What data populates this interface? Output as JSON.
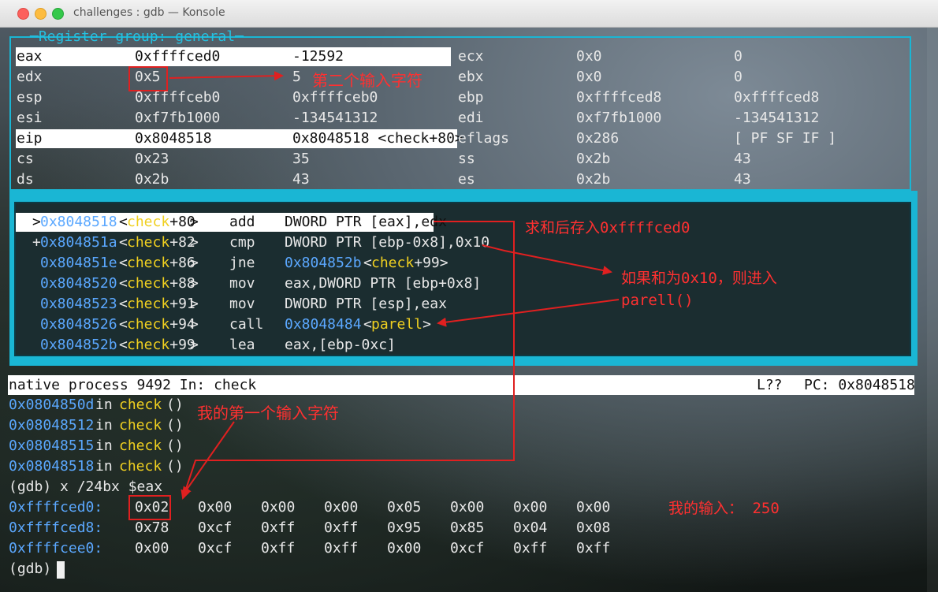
{
  "window": {
    "title": "challenges : gdb — Konsole"
  },
  "registers": {
    "group_title": "Register group: general",
    "rows": [
      [
        "eax",
        "0xffffced0",
        "-12592",
        "ecx",
        "0x0",
        "0"
      ],
      [
        "edx",
        "0x5",
        "5",
        "ebx",
        "0x0",
        "0"
      ],
      [
        "esp",
        "0xffffceb0",
        "0xffffceb0",
        "ebp",
        "0xffffced8",
        "0xffffced8"
      ],
      [
        "esi",
        "0xf7fb1000",
        "-134541312",
        "edi",
        "0xf7fb1000",
        "-134541312"
      ],
      [
        "eip",
        "0x8048518",
        "0x8048518 <check+80>",
        "eflags",
        "0x286",
        "[ PF SF IF ]"
      ],
      [
        "cs",
        "0x23",
        "35",
        "ss",
        "0x2b",
        "43"
      ],
      [
        "ds",
        "0x2b",
        "43",
        "es",
        "0x2b",
        "43"
      ]
    ]
  },
  "asm": {
    "lines": [
      {
        "marker": ">",
        "addr": "0x8048518",
        "func": "check",
        "off": "+80",
        "op": "add",
        "args": "DWORD PTR [eax],edx"
      },
      {
        "marker": "+",
        "addr": "0x804851a",
        "func": "check",
        "off": "+82",
        "op": "cmp",
        "args": "DWORD PTR [ebp-0x8],0x10"
      },
      {
        "marker": "",
        "addr": "0x804851e",
        "func": "check",
        "off": "+86",
        "op": "jne",
        "args_addr": "0x804852b",
        "args_func": "check",
        "args_off": "+99"
      },
      {
        "marker": "",
        "addr": "0x8048520",
        "func": "check",
        "off": "+88",
        "op": "mov",
        "args": "eax,DWORD PTR [ebp+0x8]"
      },
      {
        "marker": "",
        "addr": "0x8048523",
        "func": "check",
        "off": "+91",
        "op": "mov",
        "args": "DWORD PTR [esp],eax"
      },
      {
        "marker": "",
        "addr": "0x8048526",
        "func": "check",
        "off": "+94",
        "op": "call",
        "args_addr": "0x8048484",
        "args_func": "parell",
        "args_off": ""
      },
      {
        "marker": "",
        "addr": "0x804852b",
        "func": "check",
        "off": "+99",
        "op": "lea",
        "args": "eax,[ebp-0xc]"
      }
    ]
  },
  "status": {
    "left": "native process 9492 In: check",
    "line": "L??",
    "pc": "PC: 0x8048518"
  },
  "console": {
    "frames": [
      {
        "addr": "0x0804850d",
        "in": "in",
        "func": "check",
        "paren": "()"
      },
      {
        "addr": "0x08048512",
        "in": "in",
        "func": "check",
        "paren": "()"
      },
      {
        "addr": "0x08048515",
        "in": "in",
        "func": "check",
        "paren": "()"
      },
      {
        "addr": "0x08048518",
        "in": "in",
        "func": "check",
        "paren": "()"
      }
    ],
    "command": "(gdb) x /24bx $eax",
    "memory": [
      {
        "addr": "0xffffced0:",
        "bytes": [
          "0x02",
          "0x00",
          "0x00",
          "0x00",
          "0x05",
          "0x00",
          "0x00",
          "0x00"
        ]
      },
      {
        "addr": "0xffffced8:",
        "bytes": [
          "0x78",
          "0xcf",
          "0xff",
          "0xff",
          "0x95",
          "0x85",
          "0x04",
          "0x08"
        ]
      },
      {
        "addr": "0xffffcee0:",
        "bytes": [
          "0x00",
          "0xcf",
          "0xff",
          "0xff",
          "0x00",
          "0xcf",
          "0xff",
          "0xff"
        ]
      }
    ],
    "prompt": "(gdb) "
  },
  "annotations": {
    "second_char": "第二个输入字符",
    "sum_stored": "求和后存入0xffffced0",
    "if_sum": "如果和为0x10，则进入",
    "parell_call": "parell()",
    "first_char": "我的第一个输入字符",
    "my_input": "我的输入： 250"
  },
  "colors": {
    "cyan": "#26c0e0",
    "blue_addr": "#5ba8ff",
    "yellow_func": "#f0d020",
    "annotation_red": "#ff3030"
  }
}
